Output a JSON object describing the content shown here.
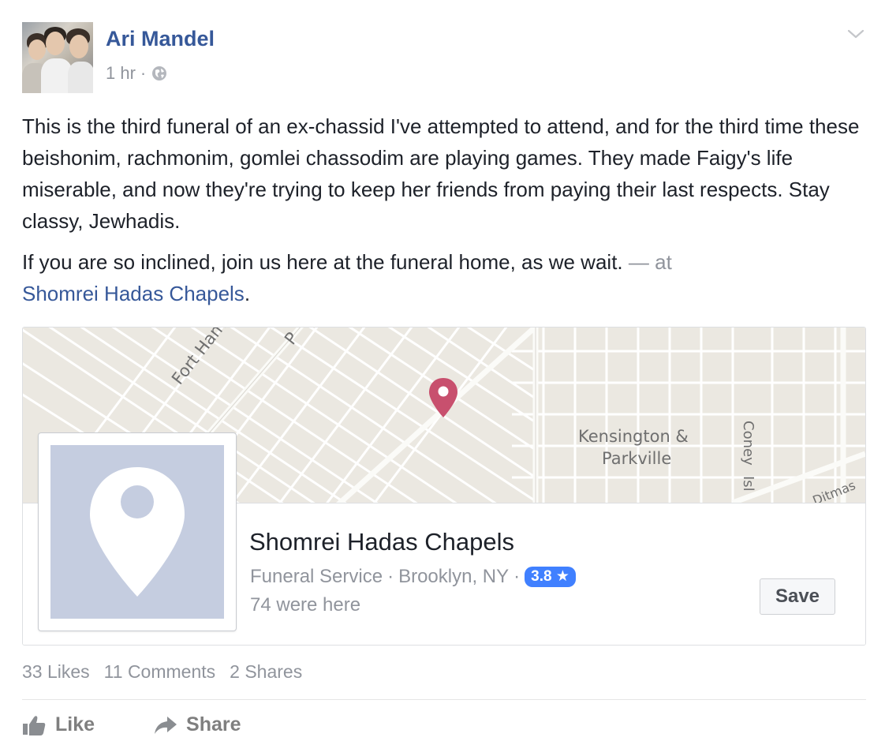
{
  "post": {
    "author": "Ari Mandel",
    "time": "1 hr",
    "separator": "·",
    "audience_icon": "globe-icon",
    "menu_icon": "chevron-down-icon",
    "paragraph1": "This is the third funeral of an ex-chassid I've attempted to attend, and for the third time these beishonim, rachmonim, gomlei chassodim are playing games. They made Faigy's life miserable, and now they're trying to keep her friends from paying their last respects. Stay classy, Jewhadis.",
    "paragraph2_text": "If you are so inclined, join us here at the funeral home, as we wait.",
    "paragraph2_at": " — at",
    "paragraph2_place": "Shomrei Hadas Chapels",
    "paragraph2_end": "."
  },
  "place_card": {
    "map_labels": {
      "road1": "Fort Hamilton",
      "road1_suffix": "P",
      "neighborhood_line1": "Kensington &",
      "neighborhood_line2": "Parkville",
      "road2": "Coney",
      "road2_b": "Isl",
      "road3": "Ditmas"
    },
    "name": "Shomrei Hadas Chapels",
    "category": "Funeral Service",
    "location": "Brooklyn, NY",
    "rating": "3.8 ★",
    "checkins": "74 were here",
    "save_label": "Save",
    "accent_color": "#4080ff",
    "pin_color": "#c8506e"
  },
  "stats": {
    "likes": "33 Likes",
    "comments": "11 Comments",
    "shares": "2 Shares"
  },
  "actions": {
    "like": "Like",
    "share": "Share"
  }
}
